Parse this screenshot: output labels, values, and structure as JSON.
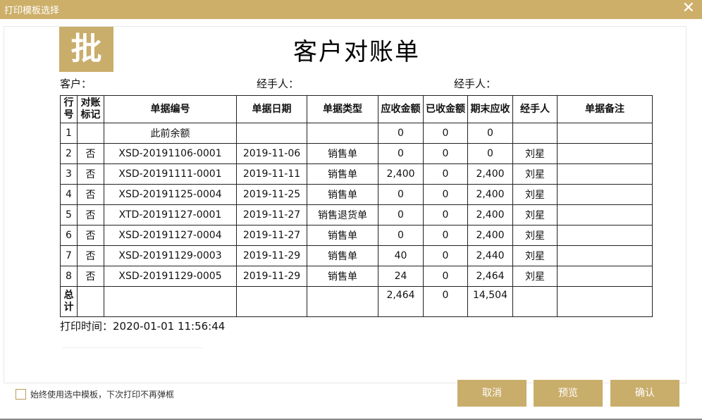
{
  "window": {
    "title": "打印模板选择",
    "close_glyph": "✕"
  },
  "logo_text": "批",
  "document": {
    "title": "客户对账单",
    "customer_label": "客户：",
    "handler_label_1": "经手人：",
    "handler_label_2": "经手人：",
    "print_time": "打印时间：2020-01-01 11:56:44"
  },
  "table": {
    "headers": [
      "行\n号",
      "对账\n标记",
      "单据编号",
      "单据日期",
      "单据类型",
      "应收金额",
      "已收金额",
      "期末应收",
      "经手人",
      "单据备注"
    ],
    "rows": [
      [
        "1",
        "",
        "此前余额",
        "",
        "",
        "0",
        "0",
        "0",
        "",
        ""
      ],
      [
        "2",
        "否",
        "XSD-20191106-0001",
        "2019-11-06",
        "销售单",
        "0",
        "0",
        "0",
        "刘星",
        ""
      ],
      [
        "3",
        "否",
        "XSD-20191111-0001",
        "2019-11-11",
        "销售单",
        "2,400",
        "0",
        "2,400",
        "刘星",
        ""
      ],
      [
        "4",
        "否",
        "XSD-20191125-0004",
        "2019-11-25",
        "销售单",
        "0",
        "0",
        "2,400",
        "刘星",
        ""
      ],
      [
        "5",
        "否",
        "XTD-20191127-0001",
        "2019-11-27",
        "销售退货单",
        "0",
        "0",
        "2,400",
        "刘星",
        ""
      ],
      [
        "6",
        "否",
        "XSD-20191127-0004",
        "2019-11-27",
        "销售单",
        "0",
        "0",
        "2,400",
        "刘星",
        ""
      ],
      [
        "7",
        "否",
        "XSD-20191129-0003",
        "2019-11-29",
        "销售单",
        "40",
        "0",
        "2,440",
        "刘星",
        ""
      ],
      [
        "8",
        "否",
        "XSD-20191129-0005",
        "2019-11-29",
        "销售单",
        "24",
        "0",
        "2,464",
        "刘星",
        ""
      ]
    ],
    "total": {
      "label": "总\n计",
      "receivable": "2,464",
      "received": "0",
      "ending": "14,504"
    }
  },
  "footer": {
    "checkbox_label": "始终使用选中模板，下次打印不再弹框",
    "cancel": "取消",
    "preview": "预览",
    "confirm": "确认"
  },
  "colors": {
    "accent": "#c9ad6b",
    "titlebar": "#cdaf69"
  }
}
